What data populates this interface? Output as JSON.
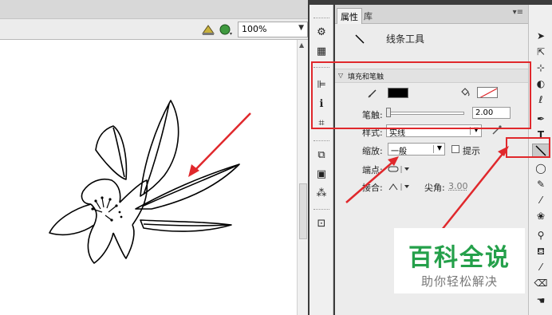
{
  "zoom": {
    "value": "100%"
  },
  "panel": {
    "tabs": [
      "属性",
      "库"
    ],
    "tool_name": "线条工具",
    "section_title": "填充和笔触",
    "stroke_label": "笔触:",
    "stroke_value": "2.00",
    "style_label": "样式:",
    "style_value": "实线",
    "scale_label": "缩放:",
    "scale_value": "一般",
    "hint_label": "提示",
    "cap_label": "端点:",
    "join_label": "接合:",
    "miter_label": "尖角:",
    "miter_value": "3.00"
  },
  "watermark": {
    "title": "百科全说",
    "subtitle": "助你轻松解决"
  },
  "colors": {
    "annotation_red": "#e0282c",
    "watermark_green": "#24a04a",
    "stroke_color": "#000000"
  },
  "icons": {
    "dock": [
      "motion-presets-icon",
      "grid-align-icon",
      "align-icon",
      "info-icon",
      "transform-icon",
      "components-icon",
      "swatches-icon",
      "color-icon",
      "library-panel-icon"
    ],
    "tools": [
      "selection-arrow-icon",
      "subselection-arrow-icon",
      "free-transform-icon",
      "gradient-transform-icon",
      "lasso-icon",
      "pen-icon",
      "text-icon",
      "line-icon",
      "rectangle-icon",
      "pencil-icon",
      "brush-icon",
      "deco-icon",
      "bone-icon",
      "paint-bucket-icon",
      "eyedropper-icon",
      "eraser-icon",
      "hand-icon",
      "zoom-icon"
    ]
  }
}
